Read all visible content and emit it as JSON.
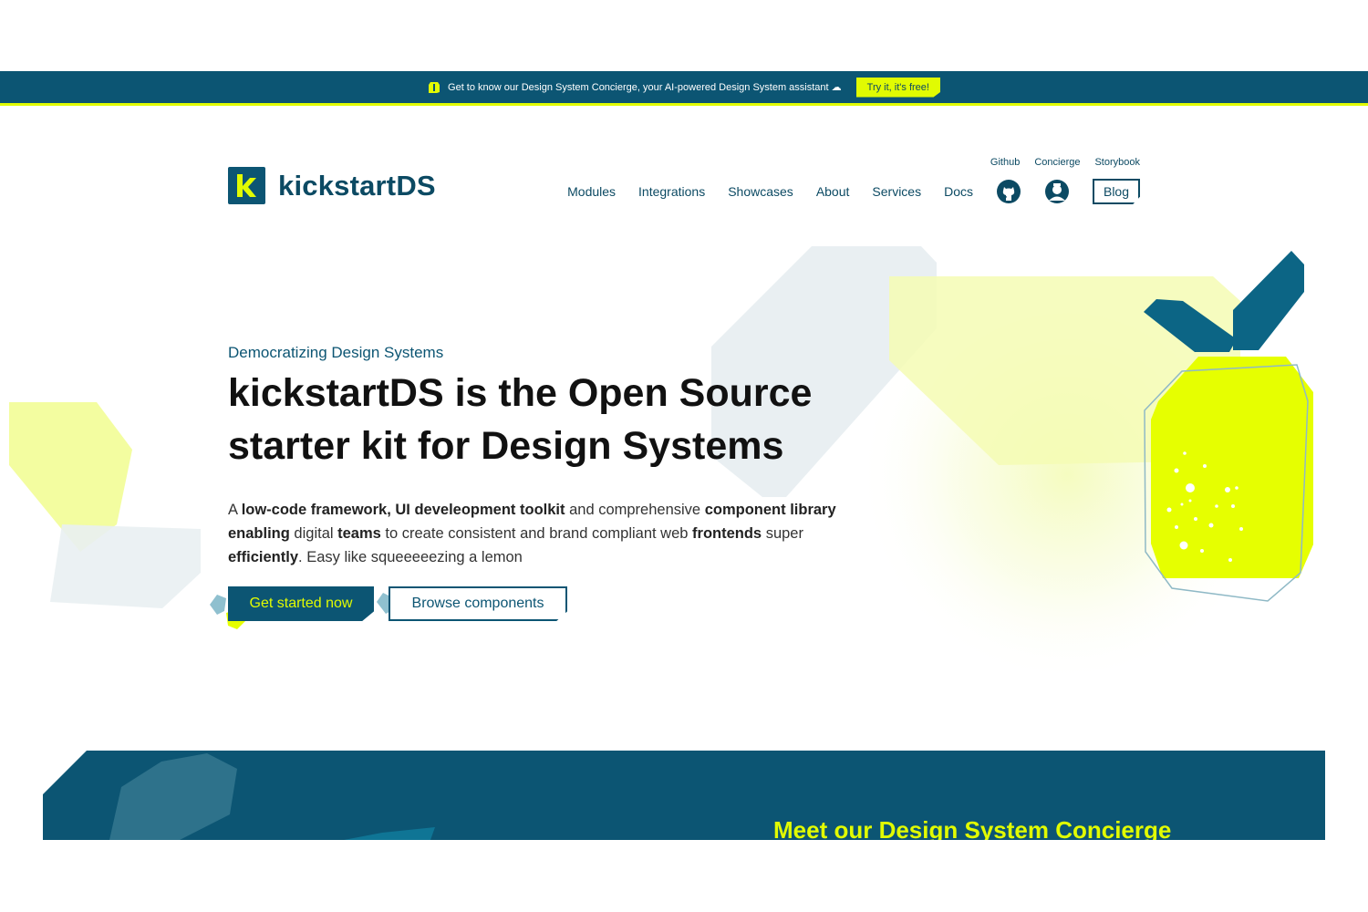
{
  "announcement": {
    "text": "Get to know our Design System Concierge, your AI-powered Design System assistant ☁",
    "button_label": "Try it, it's free!"
  },
  "header": {
    "brand": "kickstartDS",
    "meta_nav": [
      "Github",
      "Concierge",
      "Storybook"
    ],
    "main_nav": [
      "Modules",
      "Integrations",
      "Showcases",
      "About",
      "Services",
      "Docs"
    ],
    "blog_label": "Blog"
  },
  "hero": {
    "eyebrow": "Democratizing Design Systems",
    "title": "kickstartDS is the Open Source starter kit for Design Systems",
    "text": {
      "p1": "A ",
      "b1": "low-code framework, UI develeopment toolkit",
      "p2": " and comprehensive ",
      "b2": "component library",
      "p3": " ",
      "b3": "enabling",
      "p4": " digital ",
      "b4": "teams",
      "p5": " to create consistent and brand compliant web ",
      "b5": "frontends",
      "p6": " super ",
      "b6": "efficiently",
      "p7": ". Easy like squeeeeezing a lemon"
    },
    "primary_cta": "Get started now",
    "secondary_cta": "Browse components"
  },
  "teaser": {
    "title": "Meet our Design System Concierge"
  },
  "colors": {
    "brand_teal": "#0c5573",
    "accent_yellow": "#e1fb02"
  },
  "icons": [
    "gift-icon",
    "github-icon",
    "concierge-icon",
    "lemon-illustration"
  ]
}
